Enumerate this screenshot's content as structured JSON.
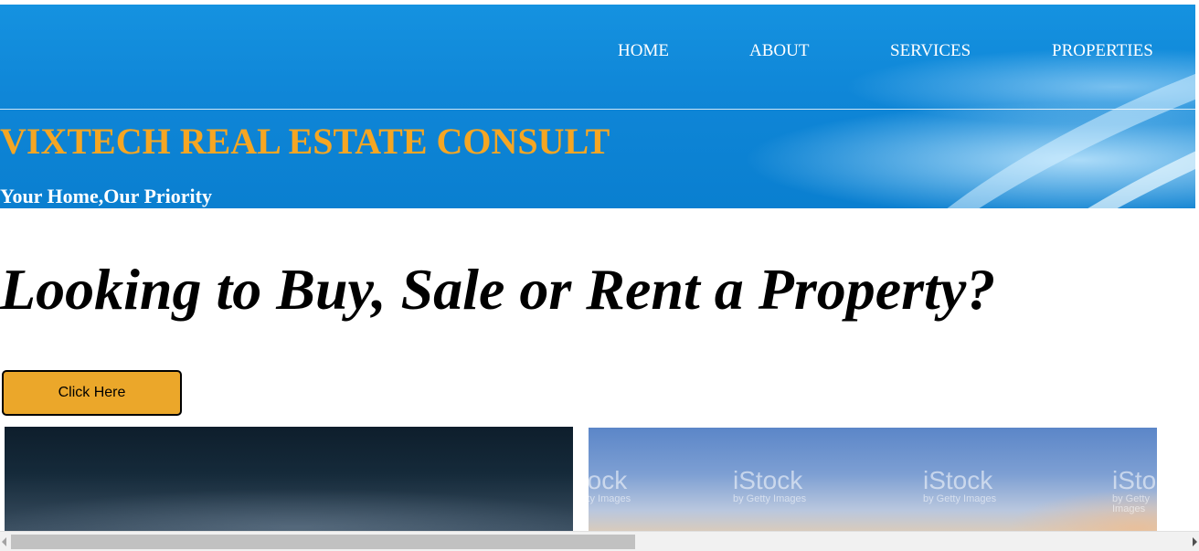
{
  "nav": {
    "items": [
      {
        "label": "HOME"
      },
      {
        "label": "ABOUT"
      },
      {
        "label": "SERVICES"
      },
      {
        "label": "PROPERTIES"
      }
    ]
  },
  "header": {
    "brand": "VIXTECH REAL ESTATE CONSULT",
    "tagline": "Your Home,Our Priority"
  },
  "main": {
    "headline": "Looking to Buy, Sale or Rent a Property?",
    "cta_label": "Click Here",
    "images": {
      "right_watermark_brand": "iStock",
      "right_watermark_sub": "by Getty Images"
    }
  },
  "colors": {
    "header_blue": "#0f86d7",
    "brand_orange": "#f5a623",
    "cta_orange": "#eba72a"
  }
}
